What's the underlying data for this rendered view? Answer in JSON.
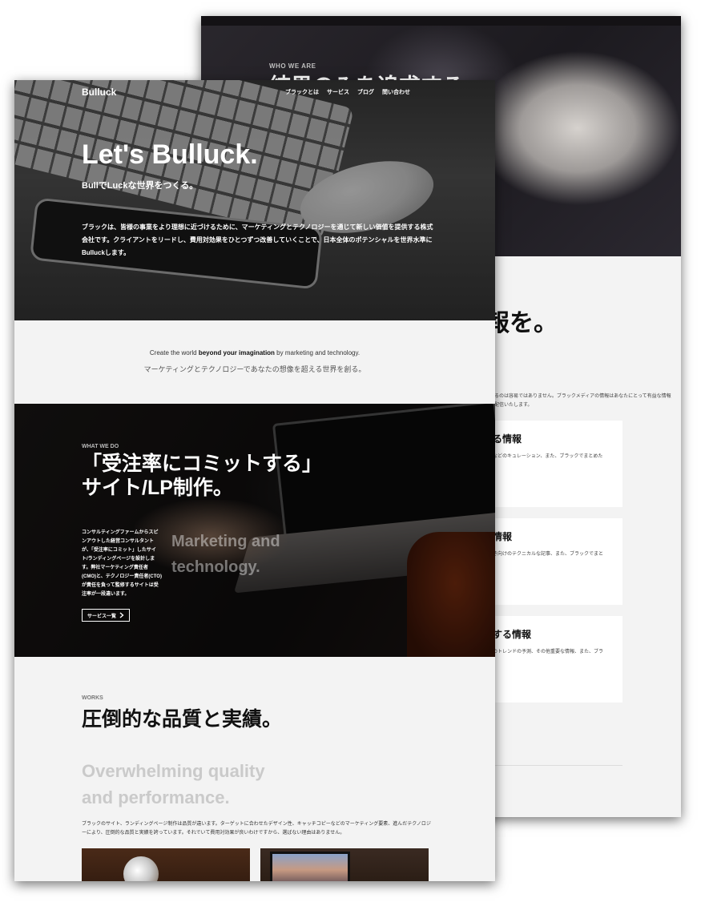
{
  "back_page": {
    "eyebrow": "WHO WE ARE",
    "hero_title": "結果のみを追求する",
    "section_title": "報を。",
    "description": "するのは容易ではありません。ブラックメディアの情報はあなたにとって有益な情報を配信いたします。",
    "cards": [
      {
        "title": "る情報",
        "desc": "などのキュレーション、また、ブラックでまとめた"
      },
      {
        "title": "情報",
        "desc": "き向けのテクニカルな記事、また、ブラックでまと"
      },
      {
        "title": "する情報",
        "desc": "のトレンドの予測、その他重要な情報、また、ブラ"
      }
    ]
  },
  "front_page": {
    "nav": {
      "logo": "Bulluck",
      "items": [
        "ブラックとは",
        "サービス",
        "ブログ",
        "問い合わせ"
      ]
    },
    "hero": {
      "title": "Let's Bulluck.",
      "subtitle": "BullでLuckな世界をつくる。",
      "description": "ブラックは、皆様の事業をより理想に近づけるために、マーケティングとテクノロジーを通じて新しい価値を提供する株式会社です。クライアントをリードし、費用対効果をひとつずつ改善していくことで、日本全体のポテンシャルを世界水準にBulluckします。"
    },
    "tagline": {
      "prefix": "Create the world ",
      "bold": "beyond your imagination",
      "suffix": " by marketing and technology.",
      "jp": "マーケティングとテクノロジーであなたの想像を超える世界を創る。"
    },
    "what_we_do": {
      "eyebrow": "WHAT WE DO",
      "title_line1": "「受注率にコミットする」",
      "title_line2": "サイト/LP制作。",
      "description": "コンサルティングファームからスピンアウトした経営コンサルタントが、「受注率にコミット」したサイト/ランディングページを設計します。弊社マーケティング責任者(CMO)と、テクノロジー責任者(CTO)が責任を負って監修するサイトは受注率が一段違います。",
      "big_text": "Marketing and technology.",
      "button_label": "サービス一覧",
      "button_icon": "chevron-right-icon"
    },
    "works": {
      "eyebrow": "WORKS",
      "title": "圧倒的な品質と実績。",
      "big_text": "Overwhelming quality and performance.",
      "description": "ブラックのサイト、ランディングページ制作は品質が違います。ターゲットに合わせたデザイン性、キャッチコピーなどのマーケティング要素、進んだテクノロジーにより、圧倒的な品質と実績を誇っています。それでいて費用対効果が良いわけですから、選ばない理由はありません。"
    }
  }
}
